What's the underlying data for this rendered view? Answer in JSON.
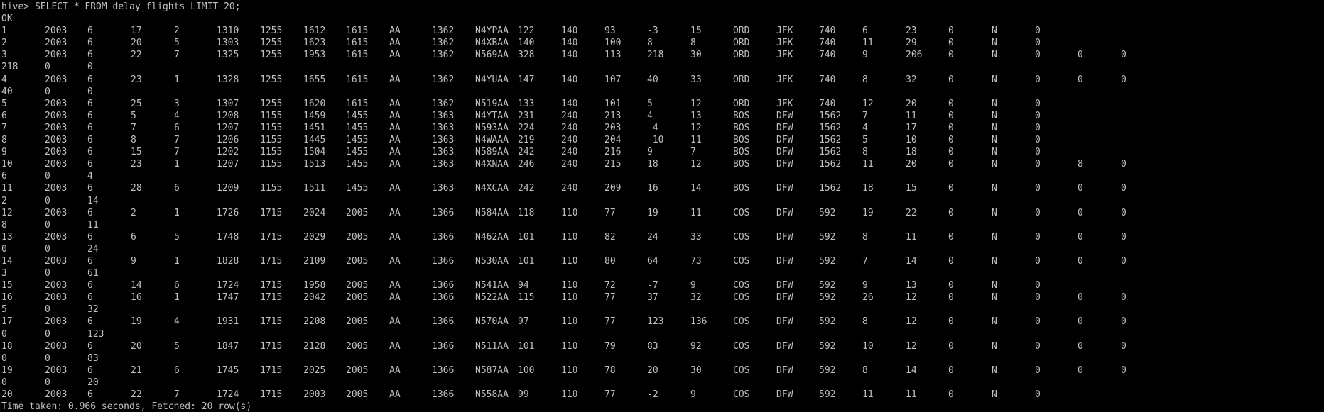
{
  "terminal": {
    "prompt": "hive> ",
    "command": "SELECT * FROM delay_flights LIMIT 20;",
    "status": "OK",
    "footer": "Time taken: 0.966 seconds, Fetched: 20 row(s)"
  },
  "rows": [
    [
      "1",
      "2003",
      "6",
      "17",
      "2",
      "1310",
      "1255",
      "1612",
      "1615",
      "AA",
      "1362",
      "N4YPAA",
      "122",
      "140",
      "93",
      "-3",
      "15",
      "ORD",
      "JFK",
      "740",
      "6",
      "23",
      "0",
      "N",
      "0"
    ],
    [
      "2",
      "2003",
      "6",
      "20",
      "5",
      "1303",
      "1255",
      "1623",
      "1615",
      "AA",
      "1362",
      "N4XBAA",
      "140",
      "140",
      "100",
      "8",
      "8",
      "ORD",
      "JFK",
      "740",
      "11",
      "29",
      "0",
      "N",
      "0"
    ],
    [
      "3",
      "2003",
      "6",
      "22",
      "7",
      "1325",
      "1255",
      "1953",
      "1615",
      "AA",
      "1362",
      "N569AA",
      "328",
      "140",
      "113",
      "218",
      "30",
      "ORD",
      "JFK",
      "740",
      "9",
      "206",
      "0",
      "N",
      "0",
      "0",
      "0",
      "218",
      "0",
      "0"
    ],
    [
      "4",
      "2003",
      "6",
      "23",
      "1",
      "1328",
      "1255",
      "1655",
      "1615",
      "AA",
      "1362",
      "N4YUAA",
      "147",
      "140",
      "107",
      "40",
      "33",
      "ORD",
      "JFK",
      "740",
      "8",
      "32",
      "0",
      "N",
      "0",
      "0",
      "0",
      "40",
      "0",
      "0"
    ],
    [
      "5",
      "2003",
      "6",
      "25",
      "3",
      "1307",
      "1255",
      "1620",
      "1615",
      "AA",
      "1362",
      "N519AA",
      "133",
      "140",
      "101",
      "5",
      "12",
      "ORD",
      "JFK",
      "740",
      "12",
      "20",
      "0",
      "N",
      "0"
    ],
    [
      "6",
      "2003",
      "6",
      "5",
      "4",
      "1208",
      "1155",
      "1459",
      "1455",
      "AA",
      "1363",
      "N4YTAA",
      "231",
      "240",
      "213",
      "4",
      "13",
      "BOS",
      "DFW",
      "1562",
      "7",
      "11",
      "0",
      "N",
      "0"
    ],
    [
      "7",
      "2003",
      "6",
      "7",
      "6",
      "1207",
      "1155",
      "1451",
      "1455",
      "AA",
      "1363",
      "N593AA",
      "224",
      "240",
      "203",
      "-4",
      "12",
      "BOS",
      "DFW",
      "1562",
      "4",
      "17",
      "0",
      "N",
      "0"
    ],
    [
      "8",
      "2003",
      "6",
      "8",
      "7",
      "1206",
      "1155",
      "1445",
      "1455",
      "AA",
      "1363",
      "N4WAAA",
      "219",
      "240",
      "204",
      "-10",
      "11",
      "BOS",
      "DFW",
      "1562",
      "5",
      "10",
      "0",
      "N",
      "0"
    ],
    [
      "9",
      "2003",
      "6",
      "15",
      "7",
      "1202",
      "1155",
      "1504",
      "1455",
      "AA",
      "1363",
      "N589AA",
      "242",
      "240",
      "216",
      "9",
      "7",
      "BOS",
      "DFW",
      "1562",
      "8",
      "18",
      "0",
      "N",
      "0"
    ],
    [
      "10",
      "2003",
      "6",
      "23",
      "1",
      "1207",
      "1155",
      "1513",
      "1455",
      "AA",
      "1363",
      "N4XNAA",
      "246",
      "240",
      "215",
      "18",
      "12",
      "BOS",
      "DFW",
      "1562",
      "11",
      "20",
      "0",
      "N",
      "0",
      "8",
      "0",
      "6",
      "0",
      "4"
    ],
    [
      "11",
      "2003",
      "6",
      "28",
      "6",
      "1209",
      "1155",
      "1511",
      "1455",
      "AA",
      "1363",
      "N4XCAA",
      "242",
      "240",
      "209",
      "16",
      "14",
      "BOS",
      "DFW",
      "1562",
      "18",
      "15",
      "0",
      "N",
      "0",
      "0",
      "0",
      "2",
      "0",
      "14"
    ],
    [
      "12",
      "2003",
      "6",
      "2",
      "1",
      "1726",
      "1715",
      "2024",
      "2005",
      "AA",
      "1366",
      "N584AA",
      "118",
      "110",
      "77",
      "19",
      "11",
      "COS",
      "DFW",
      "592",
      "19",
      "22",
      "0",
      "N",
      "0",
      "0",
      "0",
      "8",
      "0",
      "11"
    ],
    [
      "13",
      "2003",
      "6",
      "6",
      "5",
      "1748",
      "1715",
      "2029",
      "2005",
      "AA",
      "1366",
      "N462AA",
      "101",
      "110",
      "82",
      "24",
      "33",
      "COS",
      "DFW",
      "592",
      "8",
      "11",
      "0",
      "N",
      "0",
      "0",
      "0",
      "0",
      "0",
      "24"
    ],
    [
      "14",
      "2003",
      "6",
      "9",
      "1",
      "1828",
      "1715",
      "2109",
      "2005",
      "AA",
      "1366",
      "N530AA",
      "101",
      "110",
      "80",
      "64",
      "73",
      "COS",
      "DFW",
      "592",
      "7",
      "14",
      "0",
      "N",
      "0",
      "0",
      "0",
      "3",
      "0",
      "61"
    ],
    [
      "15",
      "2003",
      "6",
      "14",
      "6",
      "1724",
      "1715",
      "1958",
      "2005",
      "AA",
      "1366",
      "N541AA",
      "94",
      "110",
      "72",
      "-7",
      "9",
      "COS",
      "DFW",
      "592",
      "9",
      "13",
      "0",
      "N",
      "0"
    ],
    [
      "16",
      "2003",
      "6",
      "16",
      "1",
      "1747",
      "1715",
      "2042",
      "2005",
      "AA",
      "1366",
      "N522AA",
      "115",
      "110",
      "77",
      "37",
      "32",
      "COS",
      "DFW",
      "592",
      "26",
      "12",
      "0",
      "N",
      "0",
      "0",
      "0",
      "5",
      "0",
      "32"
    ],
    [
      "17",
      "2003",
      "6",
      "19",
      "4",
      "1931",
      "1715",
      "2208",
      "2005",
      "AA",
      "1366",
      "N570AA",
      "97",
      "110",
      "77",
      "123",
      "136",
      "COS",
      "DFW",
      "592",
      "8",
      "12",
      "0",
      "N",
      "0",
      "0",
      "0",
      "0",
      "0",
      "123"
    ],
    [
      "18",
      "2003",
      "6",
      "20",
      "5",
      "1847",
      "1715",
      "2128",
      "2005",
      "AA",
      "1366",
      "N511AA",
      "101",
      "110",
      "79",
      "83",
      "92",
      "COS",
      "DFW",
      "592",
      "10",
      "12",
      "0",
      "N",
      "0",
      "0",
      "0",
      "0",
      "0",
      "83"
    ],
    [
      "19",
      "2003",
      "6",
      "21",
      "6",
      "1745",
      "1715",
      "2025",
      "2005",
      "AA",
      "1366",
      "N587AA",
      "100",
      "110",
      "78",
      "20",
      "30",
      "COS",
      "DFW",
      "592",
      "8",
      "14",
      "0",
      "N",
      "0",
      "0",
      "0",
      "0",
      "0",
      "20"
    ],
    [
      "20",
      "2003",
      "6",
      "22",
      "7",
      "1724",
      "1715",
      "2003",
      "2005",
      "AA",
      "1366",
      "N558AA",
      "99",
      "110",
      "77",
      "-2",
      "9",
      "COS",
      "DFW",
      "592",
      "11",
      "11",
      "0",
      "N",
      "0"
    ]
  ]
}
